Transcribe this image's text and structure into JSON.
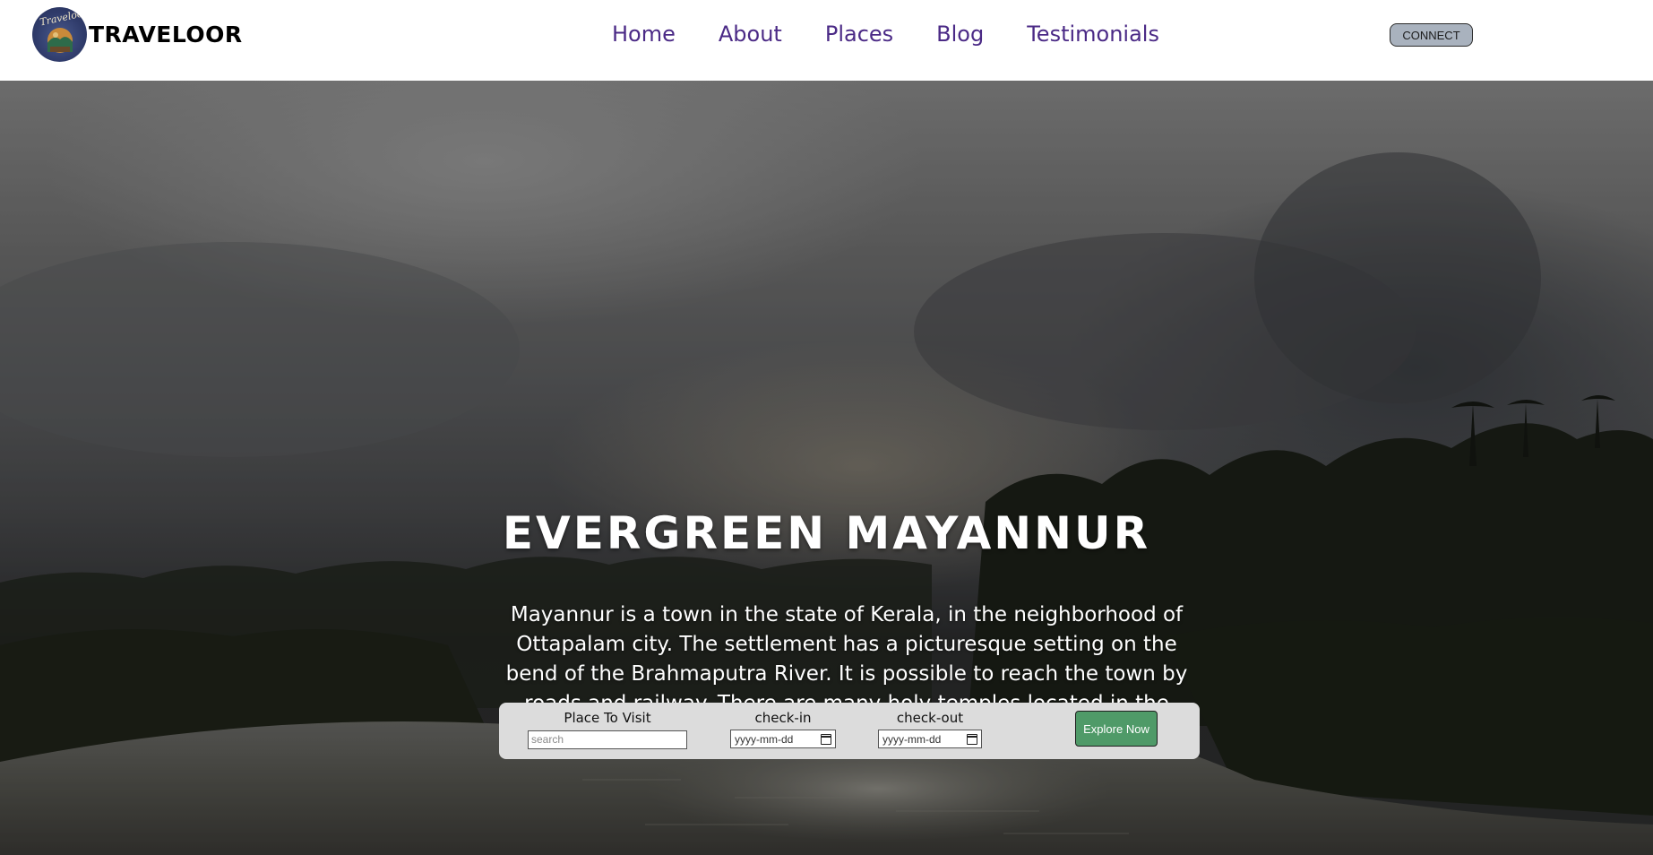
{
  "header": {
    "brand": "TRAVELOOR",
    "logo_script": "Traveloor",
    "nav": [
      "Home",
      "About",
      "Places",
      "Blog",
      "Testimonials"
    ],
    "connect_label": "CONNECT"
  },
  "hero": {
    "title": "EVERGREEN MAYANNUR",
    "description": "Mayannur is a town in the state of Kerala, in the neighborhood of Ottapalam city. The settlement has a picturesque setting on the bend of the Brahmaputra River. It is possible to reach the town by roads and railway. There are many holy temples located in the area, including Siva Temple, Kurumba Temple, etc."
  },
  "search": {
    "place_label": "Place To Visit",
    "place_placeholder": "search",
    "checkin_label": "check-in",
    "checkin_value": "yyyy-mm-dd",
    "checkout_label": "check-out",
    "checkout_value": "yyyy-mm-dd",
    "explore_label": "Explore Now"
  },
  "icons": {
    "logo": "traveloor-logo-badge",
    "calendar": "calendar-icon"
  },
  "colors": {
    "nav_text": "#4b2a86",
    "connect_bg": "#a9b2be",
    "explore_bg": "#4f9a68",
    "search_bar_bg": "#dcdcdc"
  }
}
